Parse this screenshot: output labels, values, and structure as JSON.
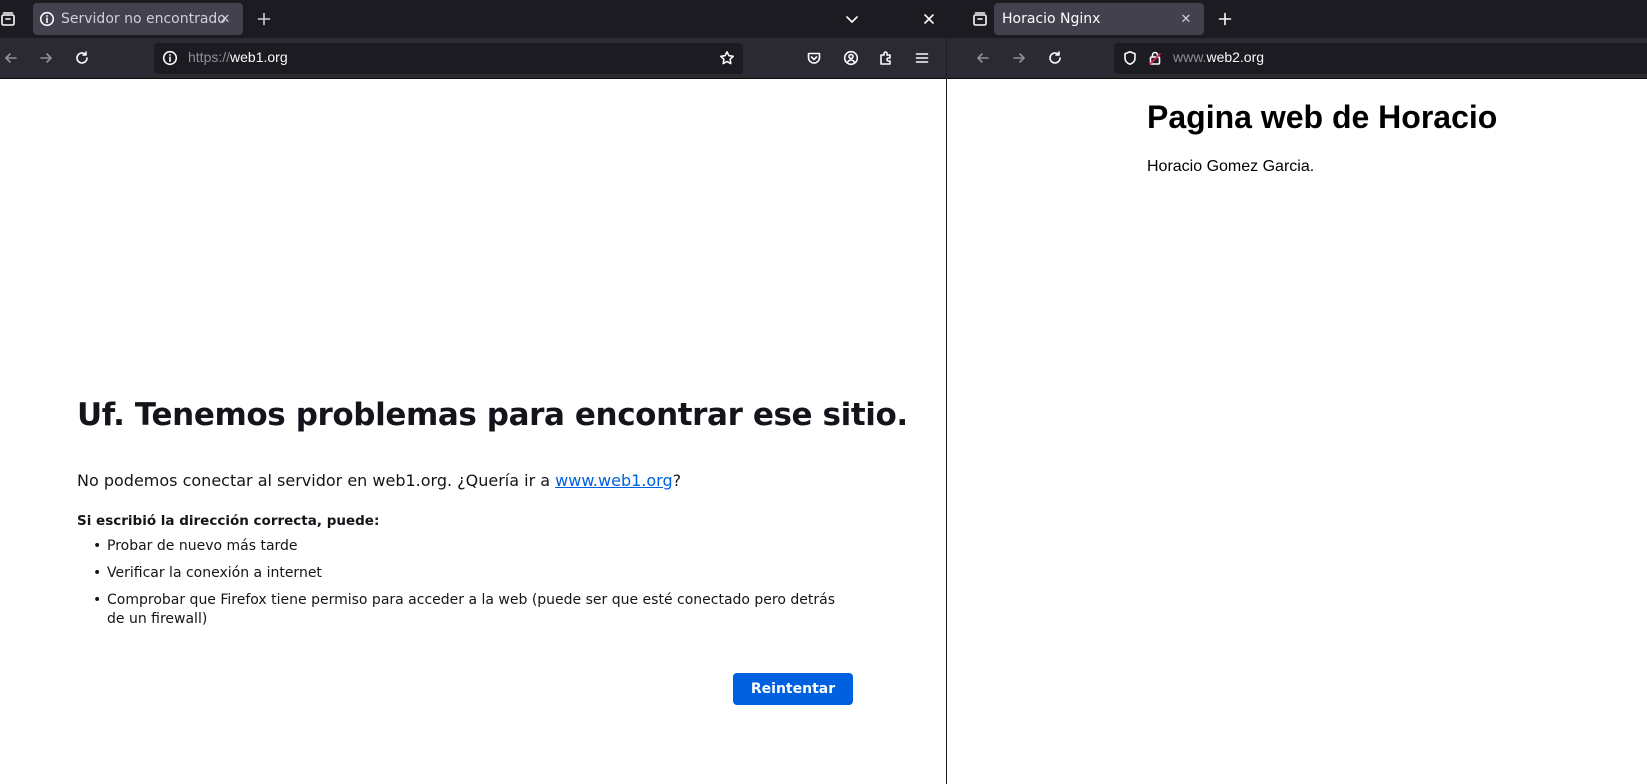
{
  "left_window": {
    "tab": {
      "title": "Servidor no encontrado",
      "icon": "info-icon"
    },
    "url": {
      "prefix": "https://",
      "host": "web1.org"
    },
    "page": {
      "title": "Uf. Tenemos problemas para encontrar ese sitio.",
      "message_before": "No podemos conectar al servidor en web1.org. ¿Quería ir a ",
      "suggestion_link": "www.web1.org",
      "message_after": "?",
      "subheading": "Si escribió la dirección correcta, puede:",
      "suggestions": [
        "Probar de nuevo más tarde",
        "Verificar la conexión a internet",
        "Comprobar que Firefox tiene permiso para acceder a la web (puede ser que esté conectado pero detrás de un firewall)"
      ],
      "bullet": "•",
      "retry_label": "Reintentar"
    }
  },
  "right_window": {
    "tab": {
      "title": "Horacio Nginx"
    },
    "url": {
      "prefix": "www.",
      "host": "web2.org"
    },
    "page": {
      "title": "Pagina web de Horacio",
      "text": "Horacio Gomez Garcia."
    }
  },
  "colors": {
    "tabbar_bg": "#1c1b22",
    "toolbar_bg": "#2b2a33",
    "tab_active_bg": "#42414d",
    "link": "#0061e0",
    "button": "#0061e0",
    "lock_warning": "#e22850"
  }
}
